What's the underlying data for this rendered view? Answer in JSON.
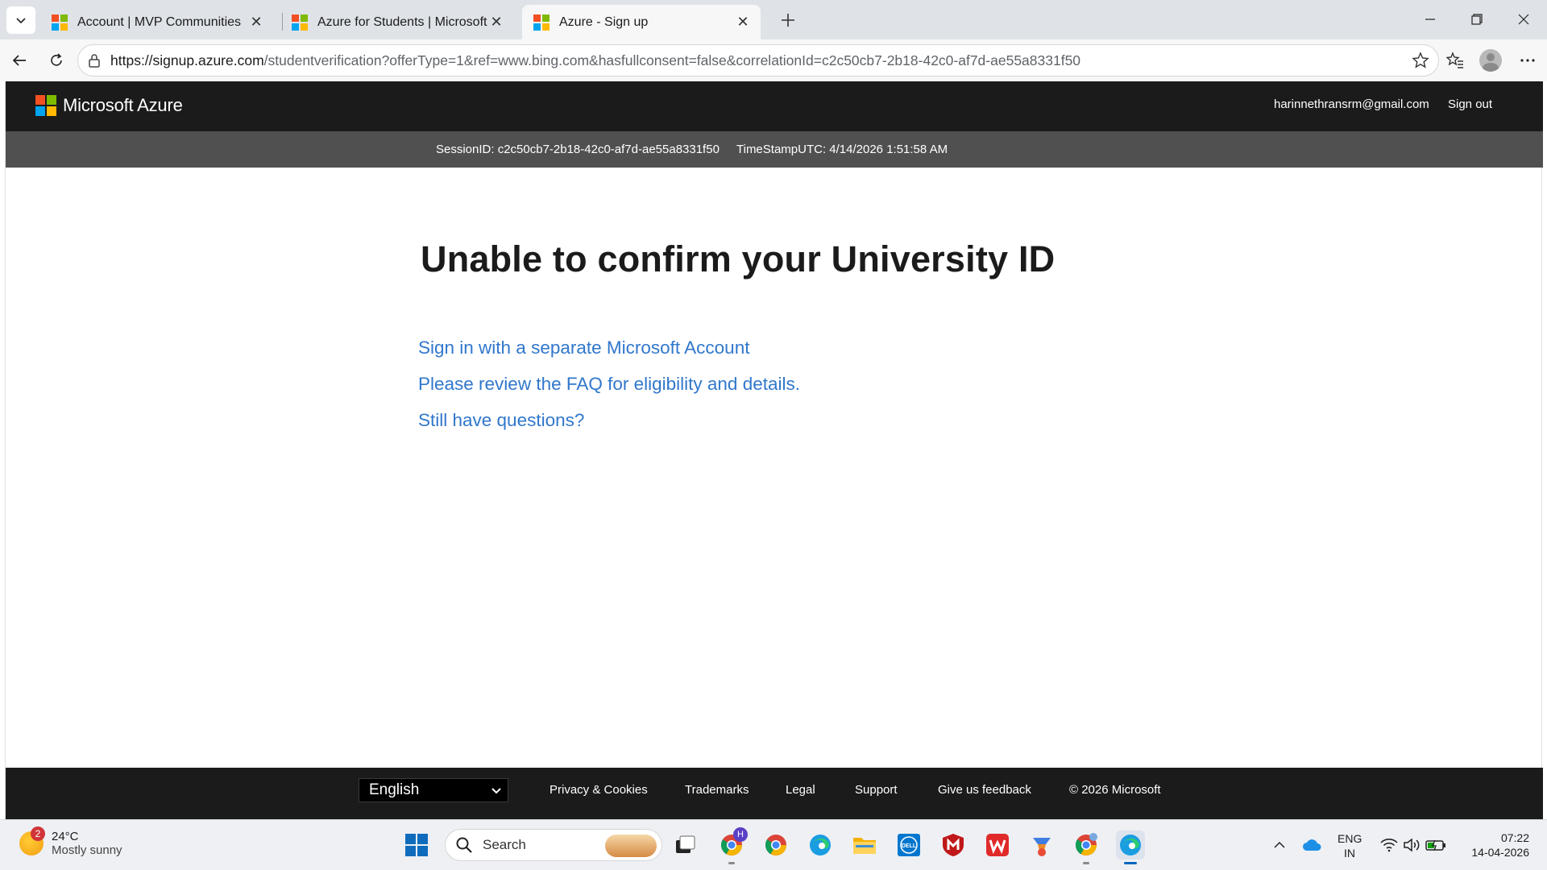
{
  "browser": {
    "tabs": [
      {
        "title": "Account | MVP Communities",
        "active": false
      },
      {
        "title": "Azure for Students | Microsoft Azu",
        "active": false
      },
      {
        "title": "Azure - Sign up",
        "active": true
      }
    ],
    "url_host": "https://signup.azure.com",
    "url_path": "/studentverification?offerType=1&ref=www.bing.com&hasfullconsent=false&correlationId=c2c50cb7-2b18-42c0-af7d-ae55a8331f50",
    "icons": [
      "tab-list-icon",
      "close-icon",
      "plus-icon",
      "minimize-icon",
      "restore-icon",
      "back-icon",
      "refresh-icon",
      "lock-icon",
      "star-icon",
      "favorites-icon",
      "profile-icon",
      "more-icon"
    ]
  },
  "header": {
    "brand": "Microsoft Azure",
    "user_email": "harinnethransrm@gmail.com",
    "sign_out": "Sign out"
  },
  "session": {
    "session_id": "SessionID: c2c50cb7-2b18-42c0-af7d-ae55a8331f50",
    "timestamp": "TimeStampUTC: 4/14/2026 1:51:58 AM"
  },
  "main": {
    "title": "Unable to confirm your University ID",
    "links": [
      "Sign in with a separate Microsoft Account",
      "Please review the FAQ for eligibility and details.",
      "Still have questions?"
    ],
    "link_color": "#3077cc"
  },
  "footer": {
    "language": "English",
    "links": [
      "Privacy & Cookies",
      "Trademarks",
      "Legal",
      "Support",
      "Give us feedback"
    ],
    "copyright": "© 2026 Microsoft"
  },
  "taskbar": {
    "weather_badge": "2",
    "temperature": "24°C",
    "condition": "Mostly sunny",
    "search_label": "Search",
    "lang_line1": "ENG",
    "lang_line2": "IN",
    "time": "07:22",
    "date": "14-04-2026",
    "profile_badge": "H"
  }
}
